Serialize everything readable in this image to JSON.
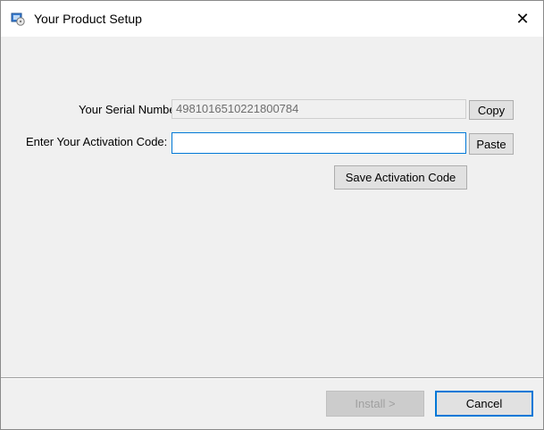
{
  "window": {
    "title": "Your Product Setup",
    "close_glyph": "✕",
    "icon": "setup-installer-icon"
  },
  "serial": {
    "label": "Your Serial Number is:",
    "value": "4981016510221800784",
    "copy_label": "Copy"
  },
  "activation": {
    "label": "Enter Your Activation Code:",
    "value": "",
    "paste_label": "Paste",
    "save_label": "Save Activation Code"
  },
  "footer": {
    "install_label": "Install >",
    "cancel_label": "Cancel"
  },
  "colors": {
    "accent": "#0078d7",
    "window_bg": "#f0f0f0"
  }
}
